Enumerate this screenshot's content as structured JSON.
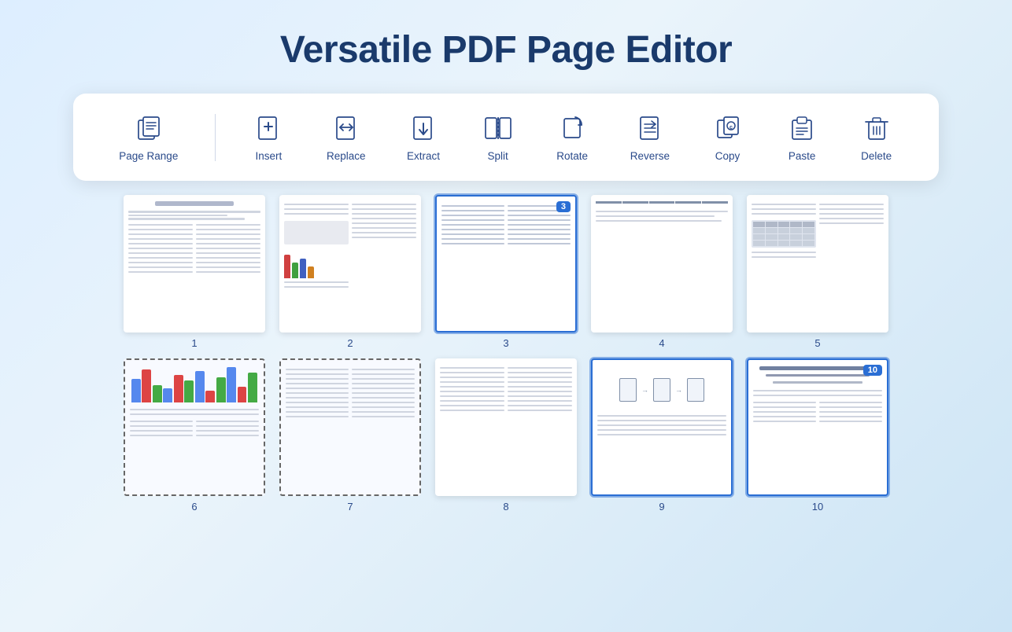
{
  "title": "Versatile PDF Page Editor",
  "toolbar": {
    "items": [
      {
        "id": "page-range",
        "label": "Page Range",
        "icon": "page-range"
      },
      {
        "id": "insert",
        "label": "Insert",
        "icon": "insert"
      },
      {
        "id": "replace",
        "label": "Replace",
        "icon": "replace"
      },
      {
        "id": "extract",
        "label": "Extract",
        "icon": "extract"
      },
      {
        "id": "split",
        "label": "Split",
        "icon": "split"
      },
      {
        "id": "rotate",
        "label": "Rotate",
        "icon": "rotate"
      },
      {
        "id": "reverse",
        "label": "Reverse",
        "icon": "reverse"
      },
      {
        "id": "copy",
        "label": "Copy",
        "icon": "copy"
      },
      {
        "id": "paste",
        "label": "Paste",
        "icon": "paste"
      },
      {
        "id": "delete",
        "label": "Delete",
        "icon": "delete"
      }
    ]
  },
  "pages": {
    "row1": [
      {
        "num": 1,
        "selected": false,
        "dashed": false,
        "type": "text"
      },
      {
        "num": 2,
        "selected": false,
        "dashed": false,
        "type": "figure"
      },
      {
        "num": 3,
        "selected": true,
        "badge": true,
        "dashed": false,
        "type": "columns"
      },
      {
        "num": 4,
        "selected": false,
        "dashed": false,
        "type": "table-heavy"
      },
      {
        "num": 5,
        "selected": false,
        "dashed": false,
        "type": "table"
      }
    ],
    "row2": [
      {
        "num": 6,
        "selected": true,
        "dashed": true,
        "type": "chart"
      },
      {
        "num": 7,
        "selected": true,
        "dashed": true,
        "type": "text"
      },
      {
        "num": 8,
        "selected": false,
        "dashed": false,
        "type": "columns"
      },
      {
        "num": 9,
        "selected": true,
        "dashed": false,
        "type": "diagram"
      },
      {
        "num": 10,
        "selected": true,
        "badge": true,
        "dashed": false,
        "type": "title-text"
      }
    ]
  },
  "colors": {
    "accent": "#2a6ed4",
    "title": "#1a3a6b",
    "toolbar_icon": "#2a4a8a"
  }
}
